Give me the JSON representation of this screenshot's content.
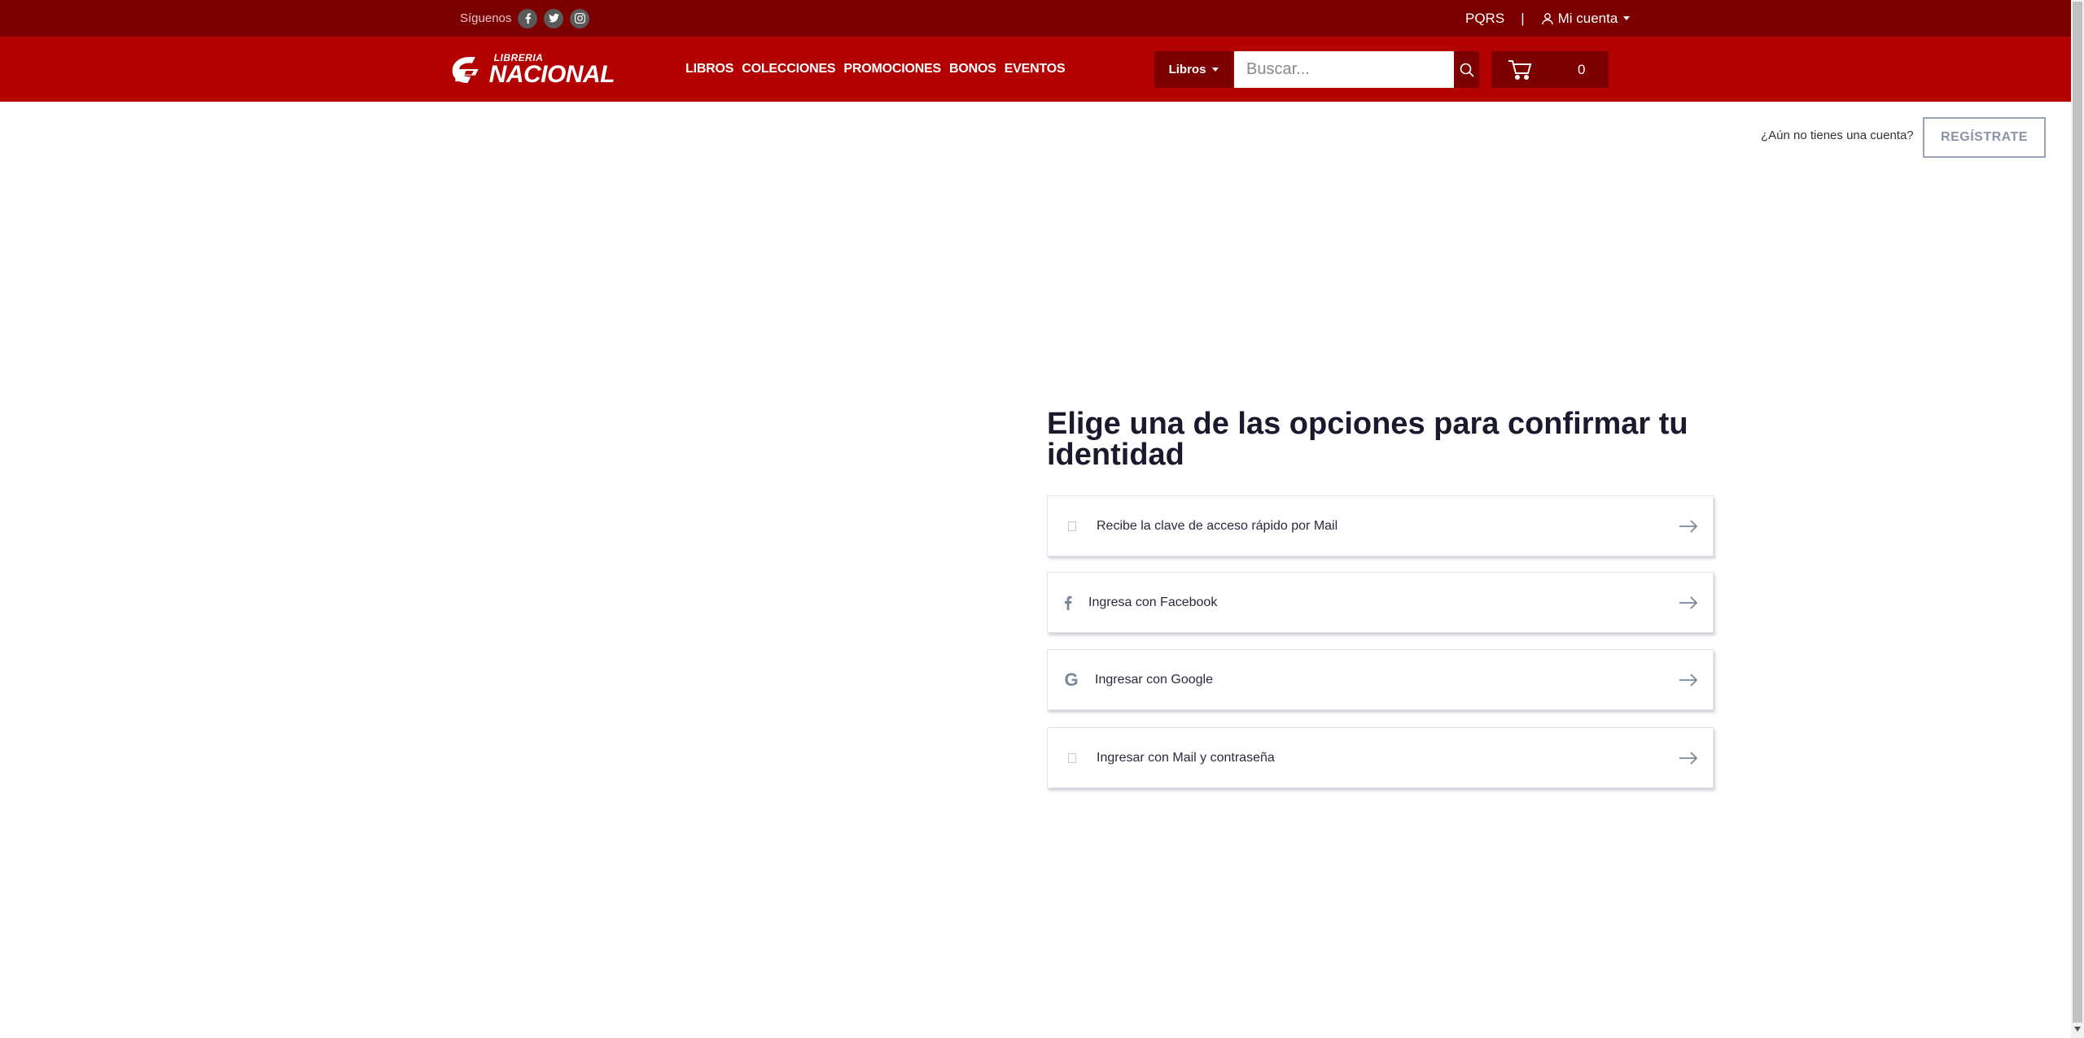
{
  "topbar": {
    "follow_label": "Síguenos",
    "social": [
      "facebook-icon",
      "twitter-icon",
      "instagram-icon"
    ],
    "pqrs": "PQRS",
    "separator": "|",
    "account_label": "Mi cuenta"
  },
  "navbar": {
    "logo_small": "LIBRERIA",
    "logo_big": "NACIONAL",
    "menu": [
      "LIBROS",
      "COLECCIONES",
      "PROMOCIONES",
      "BONOS",
      "EVENTOS"
    ],
    "search_scope": "Libros",
    "search_placeholder": "Buscar...",
    "cart_count": "0"
  },
  "auth": {
    "no_account": "¿Aún no tienes una cuenta?",
    "register": "REGÍSTRATE"
  },
  "main": {
    "heading": "Elige una de las opciones para confirmar tu identidad",
    "options": [
      {
        "label": "Recibe la clave de acceso rápido por Mail",
        "icon": "mail-icon"
      },
      {
        "label": "Ingresa con Facebook",
        "icon": "facebook-icon"
      },
      {
        "label": "Ingresar con Google",
        "icon": "google-icon"
      },
      {
        "label": "Ingresar con Mail y contraseña",
        "icon": "lock-icon"
      }
    ]
  },
  "colors": {
    "topbar": "#7d0000",
    "navbar": "#b30000",
    "text_dark": "#1a1a2e"
  }
}
